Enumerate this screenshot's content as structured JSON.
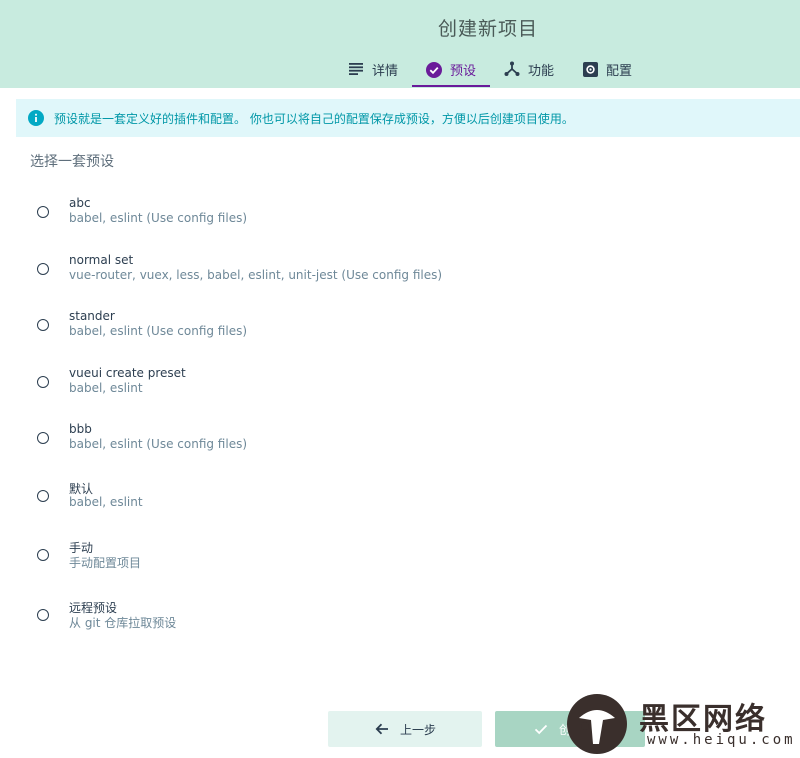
{
  "header": {
    "title": "创建新项目",
    "tabs": [
      {
        "label": "详情",
        "icon": "details-list-icon",
        "active": false
      },
      {
        "label": "预设",
        "icon": "check-circle-icon",
        "active": true
      },
      {
        "label": "功能",
        "icon": "features-icon",
        "active": false
      },
      {
        "label": "配置",
        "icon": "settings-icon",
        "active": false
      }
    ]
  },
  "info_banner": {
    "text": "预设就是一套定义好的插件和配置。 你也可以将自己的配置保存成预设，方便以后创建项目使用。",
    "icon": "info-icon"
  },
  "section_title": "选择一套预设",
  "presets": [
    {
      "name": "abc",
      "description": "babel, eslint (Use config files)"
    },
    {
      "name": "normal set",
      "description": "vue-router, vuex, less, babel, eslint, unit-jest (Use config files)"
    },
    {
      "name": "stander",
      "description": "babel, eslint (Use config files)"
    },
    {
      "name": "vueui create preset",
      "description": "babel, eslint"
    },
    {
      "name": "bbb",
      "description": "babel, eslint (Use config files)"
    },
    {
      "name": "默认",
      "description": "babel, eslint"
    },
    {
      "name": "手动",
      "description": "手动配置项目"
    },
    {
      "name": "远程预设",
      "description": "从 git 仓库拉取预设"
    }
  ],
  "footer": {
    "prev_label": "上一步",
    "create_label": "创建项目"
  },
  "watermark": {
    "text": "黑区网络",
    "url": "www.heiqu.com"
  },
  "colors": {
    "header_bg": "#c8ebdf",
    "accent": "#6a1b9a",
    "info_bg": "#e0f7fa",
    "info_text": "#0097a7"
  }
}
